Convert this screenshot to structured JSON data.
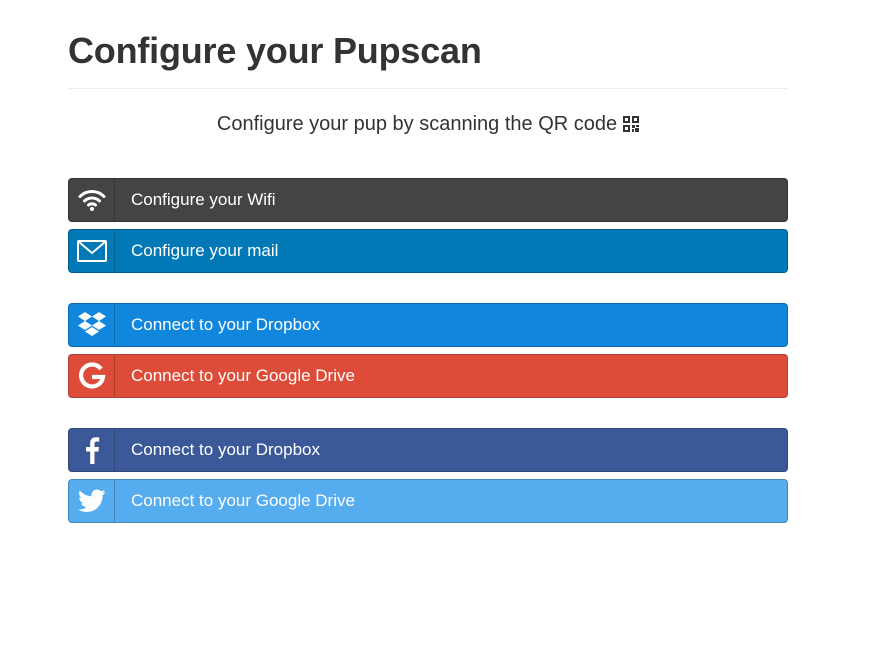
{
  "page": {
    "title": "Configure your Pupscan",
    "subtitle": "Configure your pup by scanning the QR code"
  },
  "icons": {
    "qr": "qr-code-icon",
    "wifi": "wifi-icon",
    "mail": "envelope-icon",
    "dropbox": "dropbox-icon",
    "google": "google-icon",
    "facebook": "facebook-icon",
    "twitter": "twitter-icon"
  },
  "colors": {
    "wifi": "#444444",
    "mail": "#0079b6",
    "dropbox": "#1087dd",
    "google": "#dd4b39",
    "facebook": "#3b5998",
    "twitter": "#55acee"
  },
  "config_buttons": {
    "wifi_label": "Configure your Wifi",
    "mail_label": "Configure your mail"
  },
  "storage_buttons": {
    "dropbox_label": "Connect to your Dropbox",
    "google_label": "Connect to your Google Drive"
  },
  "social_buttons": {
    "facebook_label": "Connect to your Dropbox",
    "twitter_label": "Connect to your Google Drive"
  }
}
